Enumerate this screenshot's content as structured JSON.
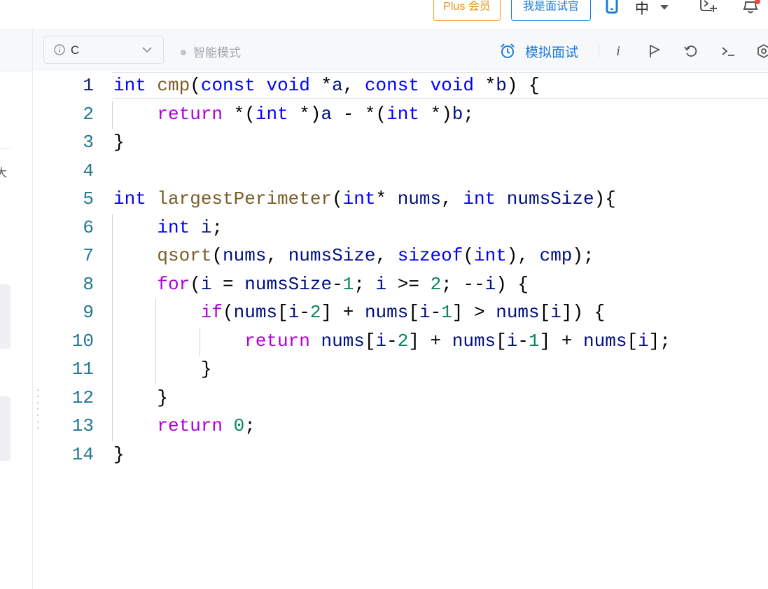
{
  "header": {
    "plus_label": "Plus 会员",
    "interviewer_label": "我是面试官",
    "language_label": "中",
    "notification_dot_color": "#f2453d",
    "accent_color": "#1a7cd9",
    "plus_color": "#e6931b"
  },
  "toolbar": {
    "language": "C",
    "smart_mode": "智能模式",
    "mock_interview": "模拟面试",
    "icons": [
      "info-italic-icon",
      "run-flag-icon",
      "reset-icon",
      "console-icon",
      "settings-icon"
    ]
  },
  "editor": {
    "current_line": 1,
    "lines": [
      {
        "no": "1",
        "tokens": [
          [
            "kw",
            "int"
          ],
          [
            "p",
            " "
          ],
          [
            "fn",
            "cmp"
          ],
          [
            "p",
            "("
          ],
          [
            "kw",
            "const"
          ],
          [
            "p",
            " "
          ],
          [
            "kw",
            "void"
          ],
          [
            "p",
            " *"
          ],
          [
            "var",
            "a"
          ],
          [
            "p",
            ", "
          ],
          [
            "kw",
            "const"
          ],
          [
            "p",
            " "
          ],
          [
            "kw",
            "void"
          ],
          [
            "p",
            " *"
          ],
          [
            "var",
            "b"
          ],
          [
            "p",
            ") {"
          ]
        ]
      },
      {
        "no": "2",
        "tokens": [
          [
            "p",
            "    "
          ],
          [
            "ctl",
            "return"
          ],
          [
            "p",
            " *("
          ],
          [
            "kw",
            "int"
          ],
          [
            "p",
            " *)"
          ],
          [
            "var",
            "a"
          ],
          [
            "p",
            " - *("
          ],
          [
            "kw",
            "int"
          ],
          [
            "p",
            " *)"
          ],
          [
            "var",
            "b"
          ],
          [
            "p",
            ";"
          ]
        ]
      },
      {
        "no": "3",
        "tokens": [
          [
            "p",
            "}"
          ]
        ]
      },
      {
        "no": "4",
        "tokens": []
      },
      {
        "no": "5",
        "tokens": [
          [
            "kw",
            "int"
          ],
          [
            "p",
            " "
          ],
          [
            "fn",
            "largestPerimeter"
          ],
          [
            "p",
            "("
          ],
          [
            "kw",
            "int"
          ],
          [
            "p",
            "* "
          ],
          [
            "var",
            "nums"
          ],
          [
            "p",
            ", "
          ],
          [
            "kw",
            "int"
          ],
          [
            "p",
            " "
          ],
          [
            "var",
            "numsSize"
          ],
          [
            "p",
            "){"
          ]
        ]
      },
      {
        "no": "6",
        "tokens": [
          [
            "p",
            "    "
          ],
          [
            "kw",
            "int"
          ],
          [
            "p",
            " "
          ],
          [
            "var",
            "i"
          ],
          [
            "p",
            ";"
          ]
        ]
      },
      {
        "no": "7",
        "tokens": [
          [
            "p",
            "    "
          ],
          [
            "fn",
            "qsort"
          ],
          [
            "p",
            "("
          ],
          [
            "var",
            "nums"
          ],
          [
            "p",
            ", "
          ],
          [
            "var",
            "numsSize"
          ],
          [
            "p",
            ", "
          ],
          [
            "kw",
            "sizeof"
          ],
          [
            "p",
            "("
          ],
          [
            "kw",
            "int"
          ],
          [
            "p",
            "), "
          ],
          [
            "var",
            "cmp"
          ],
          [
            "p",
            ");"
          ]
        ]
      },
      {
        "no": "8",
        "tokens": [
          [
            "p",
            "    "
          ],
          [
            "ctl",
            "for"
          ],
          [
            "p",
            "("
          ],
          [
            "var",
            "i"
          ],
          [
            "p",
            " = "
          ],
          [
            "var",
            "numsSize"
          ],
          [
            "p",
            "-"
          ],
          [
            "num",
            "1"
          ],
          [
            "p",
            "; "
          ],
          [
            "var",
            "i"
          ],
          [
            "p",
            " >= "
          ],
          [
            "num",
            "2"
          ],
          [
            "p",
            "; --"
          ],
          [
            "var",
            "i"
          ],
          [
            "p",
            ") {"
          ]
        ]
      },
      {
        "no": "9",
        "tokens": [
          [
            "p",
            "        "
          ],
          [
            "ctl",
            "if"
          ],
          [
            "p",
            "("
          ],
          [
            "var",
            "nums"
          ],
          [
            "p",
            "["
          ],
          [
            "var",
            "i"
          ],
          [
            "p",
            "-"
          ],
          [
            "num",
            "2"
          ],
          [
            "p",
            "] + "
          ],
          [
            "var",
            "nums"
          ],
          [
            "p",
            "["
          ],
          [
            "var",
            "i"
          ],
          [
            "p",
            "-"
          ],
          [
            "num",
            "1"
          ],
          [
            "p",
            "] > "
          ],
          [
            "var",
            "nums"
          ],
          [
            "p",
            "["
          ],
          [
            "var",
            "i"
          ],
          [
            "p",
            "]) {"
          ]
        ]
      },
      {
        "no": "10",
        "tokens": [
          [
            "p",
            "            "
          ],
          [
            "ctl",
            "return"
          ],
          [
            "p",
            " "
          ],
          [
            "var",
            "nums"
          ],
          [
            "p",
            "["
          ],
          [
            "var",
            "i"
          ],
          [
            "p",
            "-"
          ],
          [
            "num",
            "2"
          ],
          [
            "p",
            "] + "
          ],
          [
            "var",
            "nums"
          ],
          [
            "p",
            "["
          ],
          [
            "var",
            "i"
          ],
          [
            "p",
            "-"
          ],
          [
            "num",
            "1"
          ],
          [
            "p",
            "] + "
          ],
          [
            "var",
            "nums"
          ],
          [
            "p",
            "["
          ],
          [
            "var",
            "i"
          ],
          [
            "p",
            "];"
          ]
        ]
      },
      {
        "no": "11",
        "tokens": [
          [
            "p",
            "        }"
          ]
        ]
      },
      {
        "no": "12",
        "tokens": [
          [
            "p",
            "    }"
          ]
        ]
      },
      {
        "no": "13",
        "tokens": [
          [
            "p",
            "    "
          ],
          [
            "ctl",
            "return"
          ],
          [
            "p",
            " "
          ],
          [
            "num",
            "0"
          ],
          [
            "p",
            ";"
          ]
        ]
      },
      {
        "no": "14",
        "tokens": [
          [
            "p",
            "}"
          ]
        ]
      }
    ]
  }
}
